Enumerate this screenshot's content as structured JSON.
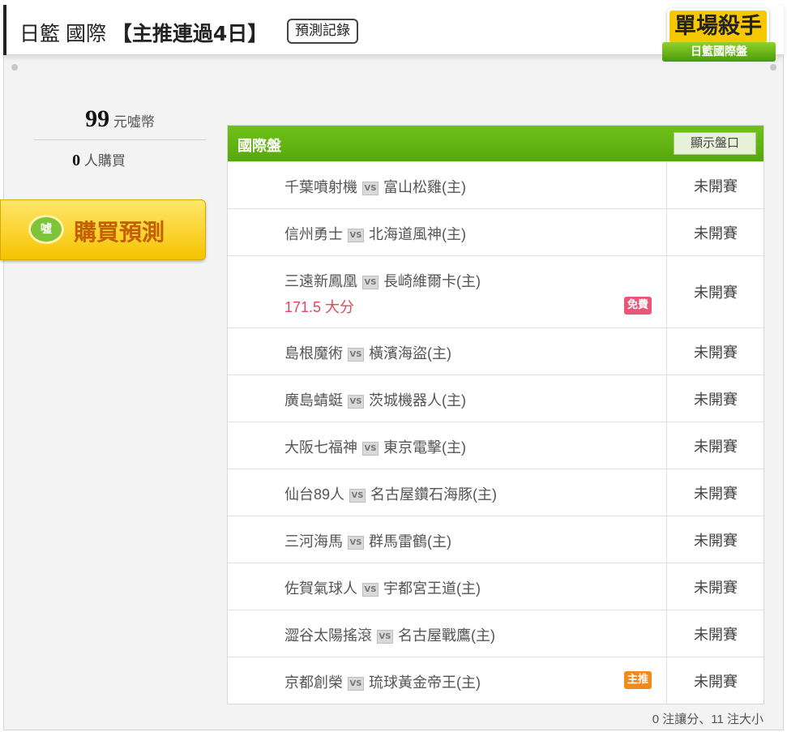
{
  "header": {
    "title_prefix": "日籃 國際",
    "title_highlight": "【主推連過4日】",
    "record_button": "預測記錄"
  },
  "badge": {
    "main": "單場殺手",
    "sub": "日籃國際盤"
  },
  "purchase": {
    "price_value": "99",
    "price_unit": "元噓幣",
    "buyers_value": "0",
    "buyers_unit": "人購買",
    "buy_button": "購買預測",
    "coin_label": "噓"
  },
  "table": {
    "title": "國際盤",
    "show_button": "顯示盤口",
    "vs_label": "VS",
    "rows": [
      {
        "away": "千葉噴射機",
        "home": "富山松雞(主)",
        "status": "未開賽"
      },
      {
        "away": "信州勇士",
        "home": "北海道風神(主)",
        "status": "未開賽"
      },
      {
        "away": "三遠新鳳凰",
        "home": "長崎維爾卡(主)",
        "status": "未開賽",
        "pick": "171.5 大分",
        "tag": "免費"
      },
      {
        "away": "島根魔術",
        "home": "橫濱海盜(主)",
        "status": "未開賽"
      },
      {
        "away": "廣島蜻蜓",
        "home": "茨城機器人(主)",
        "status": "未開賽"
      },
      {
        "away": "大阪七福神",
        "home": "東京電擊(主)",
        "status": "未開賽"
      },
      {
        "away": "仙台89人",
        "home": "名古屋鑽石海豚(主)",
        "status": "未開賽"
      },
      {
        "away": "三河海馬",
        "home": "群馬雷鶴(主)",
        "status": "未開賽"
      },
      {
        "away": "佐賀氣球人",
        "home": "宇都宮王道(主)",
        "status": "未開賽"
      },
      {
        "away": "澀谷太陽搖滾",
        "home": "名古屋戰鷹(主)",
        "status": "未開賽"
      },
      {
        "away": "京都創榮",
        "home": "琉球黃金帝王(主)",
        "status": "未開賽",
        "tag": "主推"
      }
    ]
  },
  "summary": "0 注讓分、11 注大小"
}
